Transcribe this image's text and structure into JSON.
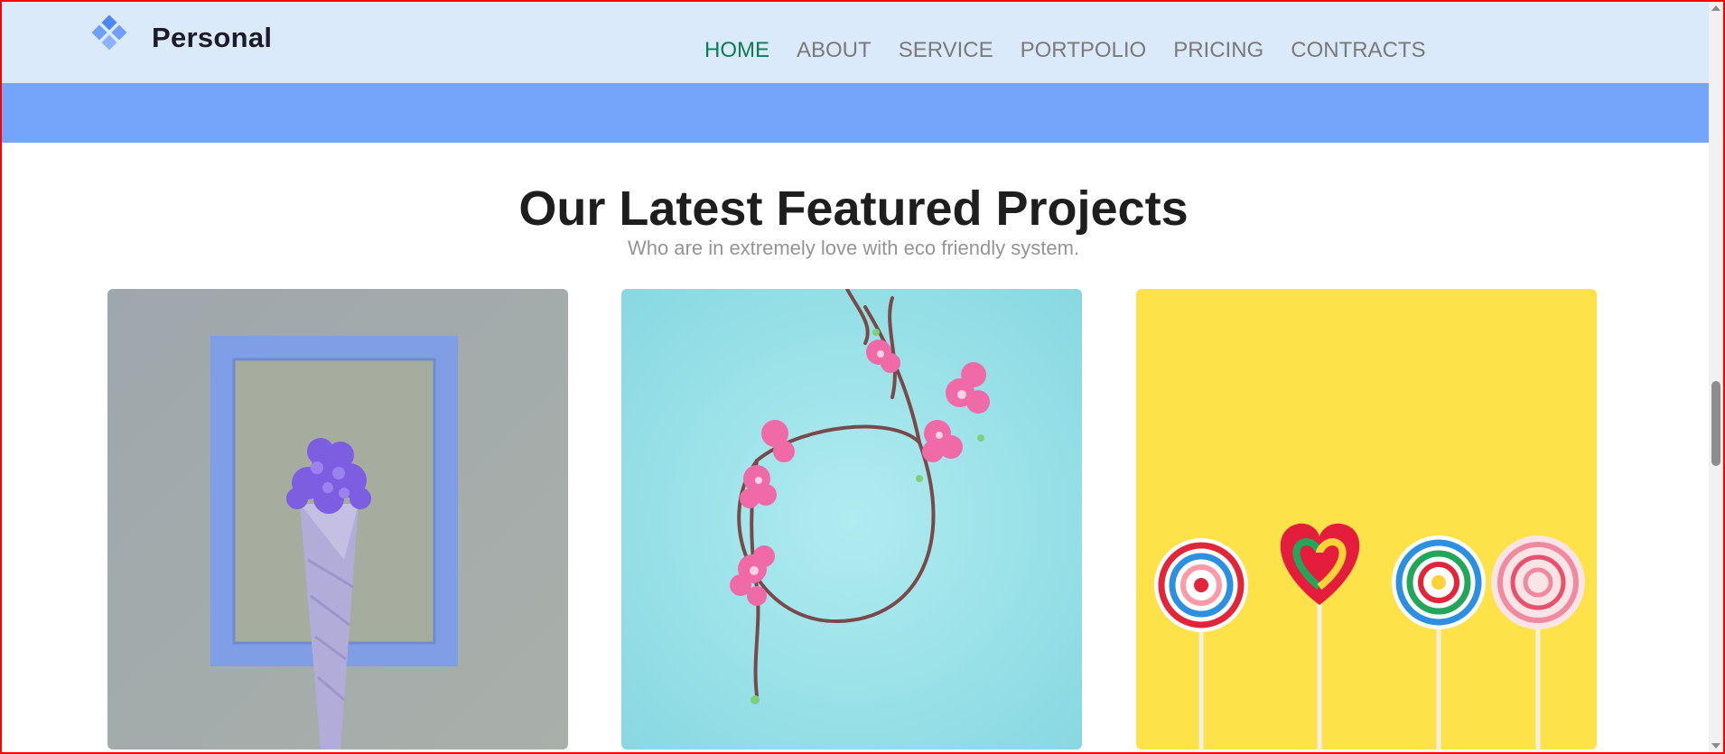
{
  "brand": {
    "name": "Personal",
    "logo_icon": "diamond-cluster-icon",
    "color": "#5e8ff7"
  },
  "nav": {
    "items": [
      {
        "label": "HOME",
        "active": true
      },
      {
        "label": "ABOUT",
        "active": false
      },
      {
        "label": "SERVICE",
        "active": false
      },
      {
        "label": "PORTPOLIO",
        "active": false
      },
      {
        "label": "PRICING",
        "active": false
      },
      {
        "label": "CONTRACTS",
        "active": false
      }
    ],
    "active_color": "#0f7a55",
    "inactive_color": "#7a7a7a"
  },
  "banner": {
    "color": "#74a5fb"
  },
  "projects": {
    "title": "Our Latest Featured Projects",
    "subtitle": "Who are in extremely love with eco friendly system.",
    "cards": [
      {
        "subject": "purple-flowers-in-cone-with-frame",
        "background": "#a5adb0"
      },
      {
        "subject": "pink-blossom-wreath",
        "background": "#a6e5ec"
      },
      {
        "subject": "four-lollipops",
        "background": "#fde24a"
      }
    ]
  }
}
